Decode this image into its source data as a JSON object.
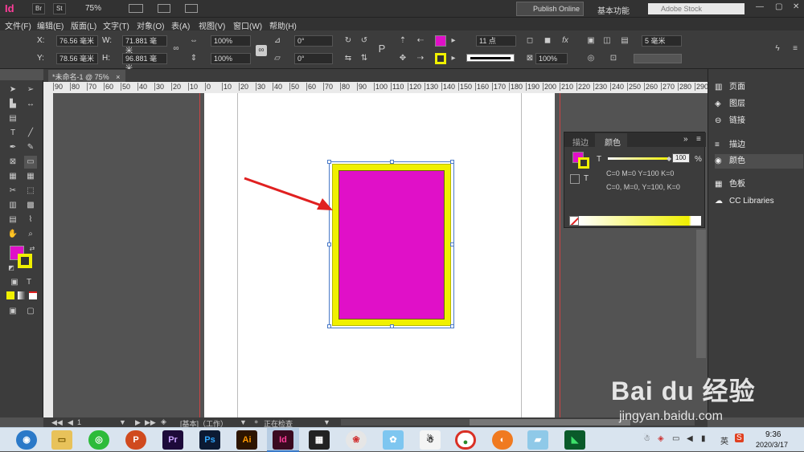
{
  "app": {
    "logo": "Id",
    "bridge": "Br",
    "stock": "St",
    "zoom": "75%",
    "publish": "Publish Online",
    "workspace": "基本功能",
    "search_placeholder": "Adobe Stock"
  },
  "menu": [
    "文件(F)",
    "编辑(E)",
    "版面(L)",
    "文字(T)",
    "对象(O)",
    "表(A)",
    "视图(V)",
    "窗口(W)",
    "帮助(H)"
  ],
  "control": {
    "x": "76.56 毫米",
    "y": "78.56 毫米",
    "w": "71.881 毫米",
    "h": "96.881 毫米",
    "scale_x": "100%",
    "scale_y": "100%",
    "angle": "0°",
    "shear": "0°",
    "stroke_weight": "11 点",
    "opacity": "100%",
    "offset": "5 毫米"
  },
  "tab": {
    "title": "*未命名-1 @ 75%",
    "close": "×"
  },
  "ruler_h": [
    "90",
    "80",
    "70",
    "60",
    "50",
    "40",
    "30",
    "20",
    "10",
    "0",
    "10",
    "20",
    "30",
    "40",
    "50",
    "60",
    "70",
    "80",
    "90",
    "100",
    "110",
    "120",
    "130",
    "140",
    "150",
    "160",
    "170",
    "180",
    "190",
    "200",
    "210",
    "220",
    "230",
    "240",
    "250",
    "260",
    "270",
    "280",
    "290"
  ],
  "panels": {
    "items": [
      "页面",
      "图层",
      "链接",
      "描边",
      "颜色",
      "色板",
      "CC Libraries"
    ]
  },
  "color_panel": {
    "tab1": "描边",
    "tab2": "颜色",
    "tint": "100",
    "pct": "%",
    "line1": "C=0 M=0 Y=100 K=0",
    "line2": "C=0, M=0, Y=100, K=0",
    "fill_color": "#e010c8",
    "stroke_color": "#f0f000"
  },
  "status": {
    "page": "1",
    "state": "[基本]（工作）",
    "preflight": "正在检查"
  },
  "taskbar": {
    "time": "9:36",
    "date": "2020/3/17",
    "apps": [
      "Pr",
      "Ps",
      "Ai",
      "Id"
    ]
  },
  "watermark": {
    "brand": "Bai du 经验",
    "url": "jingyan.baidu.com"
  }
}
